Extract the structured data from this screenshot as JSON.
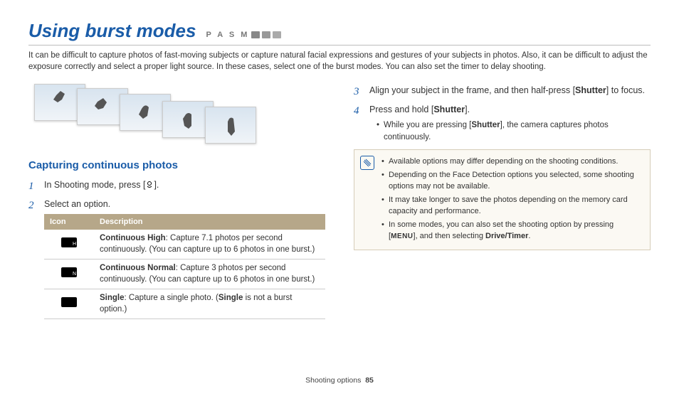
{
  "header": {
    "title": "Using burst modes",
    "mode_letters": "P A S M"
  },
  "intro": "It can be difficult to capture photos of fast-moving subjects or capture natural facial expressions and gestures of your subjects in photos. Also, it can be difficult to adjust the exposure correctly and select a proper light source. In these cases, select one of the burst modes. You can also set the timer to delay shooting.",
  "left": {
    "subheading": "Capturing continuous photos",
    "step1_pre": "In Shooting mode, press [",
    "step1_post": "].",
    "step2": "Select an option.",
    "table": {
      "head_icon": "Icon",
      "head_desc": "Description",
      "rows": [
        {
          "bold": "Continuous High",
          "rest": ": Capture 7.1 photos per second continuously. (You can capture up to 6 photos in one burst.)"
        },
        {
          "bold": "Continuous Normal",
          "rest": ": Capture 3 photos per second continuously. (You can capture up to 6 photos in one burst.)"
        },
        {
          "bold": "Single",
          "rest": ": Capture a single photo. (",
          "bold2": "Single",
          "rest2": " is not a burst option.)"
        }
      ]
    }
  },
  "right": {
    "step3_pre": "Align your subject in the frame, and then half-press [",
    "step3_bold": "Shutter",
    "step3_post": "] to focus.",
    "step4_pre": "Press and hold [",
    "step4_bold": "Shutter",
    "step4_post": "].",
    "step4_sub_pre": "While you are pressing [",
    "step4_sub_bold": "Shutter",
    "step4_sub_post": "], the camera captures photos continuously.",
    "note": {
      "items": [
        "Available options may differ depending on the shooting conditions.",
        "Depending on the Face Detection options you selected, some shooting options may not be available.",
        "It may take longer to save the photos depending on the memory card capacity and performance."
      ],
      "last_pre": "In some modes, you can also set the shooting option by pressing [",
      "last_menu": "MENU",
      "last_mid": "], and then selecting ",
      "last_bold": "Drive/Timer",
      "last_post": "."
    }
  },
  "footer": {
    "section": "Shooting options",
    "page": "85"
  }
}
